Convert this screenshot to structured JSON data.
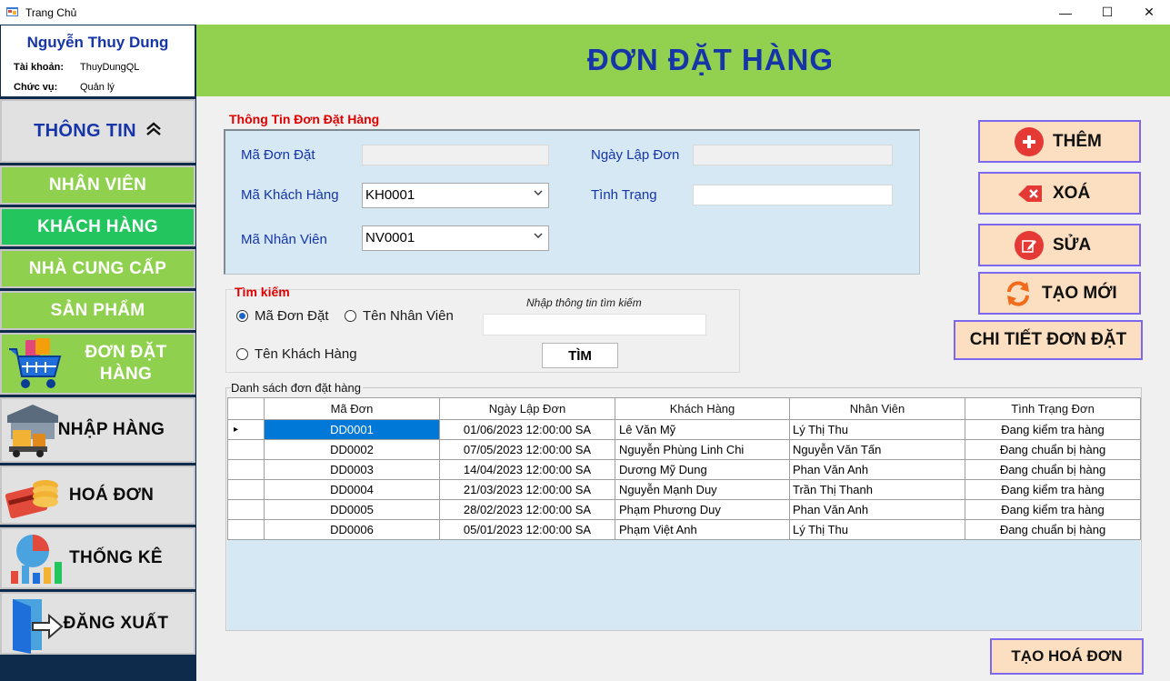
{
  "window": {
    "title": "Trang Chủ",
    "minimize": "—",
    "maximize": "☐",
    "close": "✕"
  },
  "user": {
    "name": "Nguyễn Thuy Dung",
    "account_label": "Tài khoản:",
    "account_value": "ThuyDungQL",
    "role_label": "Chức vụ:",
    "role_value": "Quản lý"
  },
  "nav": {
    "info": "THÔNG TIN",
    "info_icon": "chevron-double-up",
    "employees": "NHÂN VIÊN",
    "customers": "KHÁCH HÀNG",
    "suppliers": "NHÀ CUNG CẤP",
    "products": "SẢN PHẨM",
    "orders": "ĐƠN ĐẶT HÀNG",
    "imports": "NHẬP HÀNG",
    "invoices": "HOÁ ĐƠN",
    "stats": "THỐNG KÊ",
    "logout": "ĐĂNG XUẤT"
  },
  "header": {
    "title": "ĐƠN ĐẶT HÀNG"
  },
  "form": {
    "group_title": "Thông Tin Đơn Đặt Hàng",
    "order_id_label": "Mã Đơn Đặt",
    "order_id_value": "",
    "date_label": "Ngày Lập Đơn",
    "date_value": "",
    "customer_label": "Mã Khách Hàng",
    "customer_value": "KH0001",
    "status_label": "Tình Trạng",
    "status_value": "",
    "employee_label": "Mã Nhân Viên",
    "employee_value": "NV0001"
  },
  "search": {
    "group_title": "Tìm kiếm",
    "opt_order": "Mã Đơn Đặt",
    "opt_employee": "Tên Nhân Viên",
    "opt_customer": "Tên Khách Hàng",
    "selected": "Mã Đơn Đặt",
    "hint": "Nhập thông tin tìm kiếm",
    "query": "",
    "button": "TÌM"
  },
  "list": {
    "title": "Danh sách đơn đặt hàng",
    "columns": [
      "Mã Đơn",
      "Ngày Lập Đơn",
      "Khách Hàng",
      "Nhân Viên",
      "Tình Trạng Đơn"
    ],
    "rows": [
      [
        "DD0001",
        "01/06/2023 12:00:00 SA",
        "Lê Văn Mỹ",
        "Lý Thị Thu",
        "Đang kiểm tra hàng"
      ],
      [
        "DD0002",
        "07/05/2023 12:00:00 SA",
        "Nguyễn Phùng Linh Chi",
        "Nguyễn Văn Tấn",
        "Đang chuẩn bị hàng"
      ],
      [
        "DD0003",
        "14/04/2023 12:00:00 SA",
        "Dương Mỹ Dung",
        "Phan Văn Anh",
        "Đang chuẩn bị hàng"
      ],
      [
        "DD0004",
        "21/03/2023 12:00:00 SA",
        "Nguyễn Mạnh Duy",
        "Trần Thị Thanh",
        "Đang kiểm tra hàng"
      ],
      [
        "DD0005",
        "28/02/2023 12:00:00 SA",
        "Phạm Phương Duy",
        "Phan Văn Anh",
        "Đang kiểm tra hàng"
      ],
      [
        "DD0006",
        "05/01/2023 12:00:00 SA",
        "Phạm Việt Anh",
        "Lý Thị Thu",
        "Đang chuẩn bị hàng"
      ]
    ],
    "row_marker": "▸"
  },
  "actions": {
    "add": "THÊM",
    "delete": "XOÁ",
    "edit": "SỬA",
    "refresh": "TẠO MỚI",
    "detail": "CHI TIẾT ĐƠN ĐẶT",
    "invoice": "TẠO HOÁ ĐƠN"
  },
  "colors": {
    "accent_green": "#92d050",
    "nav_active": "#22c55e",
    "title_blue": "#1535a8",
    "panel_blue": "#d5e8f4",
    "action_bg": "#fcdfc0",
    "action_border": "#7b68ee",
    "group_red": "#e00000"
  }
}
